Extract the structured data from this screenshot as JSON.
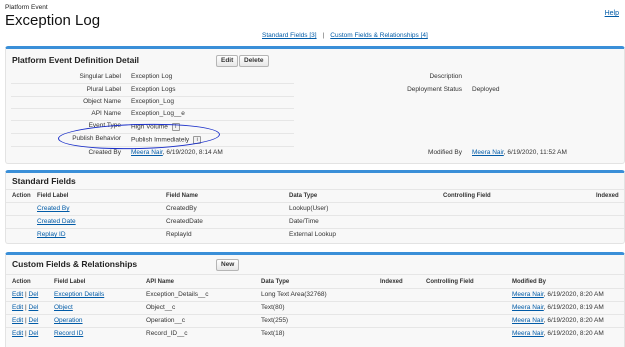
{
  "header": {
    "object_type": "Platform Event",
    "object_name": "Exception Log",
    "help_label": "Help",
    "links": [
      "Standard Fields [3]",
      "Custom Fields & Relationships [4]"
    ],
    "link_separator": "|"
  },
  "detail": {
    "title": "Platform Event Definition Detail",
    "edit_label": "Edit",
    "delete_label": "Delete",
    "left_fields": [
      {
        "label": "Singular Label",
        "value": "Exception Log"
      },
      {
        "label": "Plural Label",
        "value": "Exception Logs"
      },
      {
        "label": "Object Name",
        "value": "Exception_Log"
      },
      {
        "label": "API Name",
        "value": "Exception_Log__e"
      },
      {
        "label": "Event Type",
        "value": "High Volume"
      },
      {
        "label": "Publish Behavior",
        "value": "Publish Immediately"
      }
    ],
    "info_icon": "i",
    "created_by_label": "Created By",
    "created_by_user": "Meera Nair",
    "created_by_date": ", 6/19/2020, 8:14 AM",
    "description_label": "Description",
    "description_value": "",
    "deployment_label": "Deployment Status",
    "deployment_value": "Deployed",
    "modified_by_label": "Modified By",
    "modified_by_user": "Meera Nair",
    "modified_by_date": ", 6/19/2020, 11:52 AM"
  },
  "standard_fields": {
    "title": "Standard Fields",
    "columns": [
      "Action",
      "Field Label",
      "Field Name",
      "Data Type",
      "Controlling Field",
      "Indexed"
    ],
    "rows": [
      {
        "label": "Created By",
        "name": "CreatedBy",
        "type": "Lookup(User)"
      },
      {
        "label": "Created Date",
        "name": "CreatedDate",
        "type": "Date/Time"
      },
      {
        "label": "Replay ID",
        "name": "ReplayId",
        "type": "External Lookup"
      }
    ]
  },
  "custom_fields": {
    "title": "Custom Fields & Relationships",
    "new_label": "New",
    "columns": [
      "Action",
      "Field Label",
      "API Name",
      "Data Type",
      "Indexed",
      "Controlling Field",
      "Modified By"
    ],
    "action_edit": "Edit",
    "action_sep": "|",
    "action_del": "Del",
    "rows": [
      {
        "label": "Exception Details",
        "api": "Exception_Details__c",
        "type": "Long Text Area(32768)",
        "user": "Meera Nair",
        "date": ", 6/19/2020, 8:20 AM"
      },
      {
        "label": "Object",
        "api": "Object__c",
        "type": "Text(80)",
        "user": "Meera Nair",
        "date": ", 6/19/2020, 8:19 AM"
      },
      {
        "label": "Operation",
        "api": "Operation__c",
        "type": "Text(255)",
        "user": "Meera Nair",
        "date": ", 6/19/2020, 8:20 AM"
      },
      {
        "label": "Record ID",
        "api": "Record_ID__c",
        "type": "Text(18)",
        "user": "Meera Nair",
        "date": ", 6/19/2020, 8:20 AM"
      }
    ]
  }
}
